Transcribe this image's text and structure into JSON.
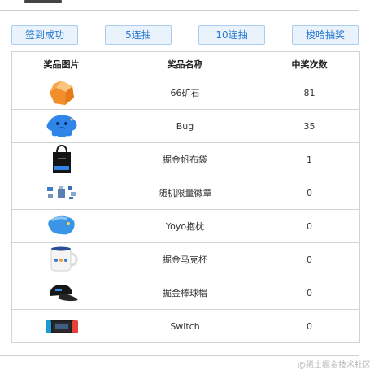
{
  "buttons": {
    "signin": "签到成功",
    "draw5": "5连抽",
    "draw10": "10连抽",
    "peek": "梭哈抽奖"
  },
  "table": {
    "headers": [
      "奖品图片",
      "奖品名称",
      "中奖次数"
    ],
    "rows": [
      {
        "icon": "ore-icon",
        "name": "66矿石",
        "count": "81"
      },
      {
        "icon": "bug-icon",
        "name": "Bug",
        "count": "35"
      },
      {
        "icon": "canvas-bag-icon",
        "name": "掘金帆布袋",
        "count": "1"
      },
      {
        "icon": "badges-icon",
        "name": "随机限量徽章",
        "count": "0"
      },
      {
        "icon": "pillow-icon",
        "name": "Yoyo抱枕",
        "count": "0"
      },
      {
        "icon": "mug-icon",
        "name": "掘金马克杯",
        "count": "0"
      },
      {
        "icon": "baseball-cap-icon",
        "name": "掘金棒球帽",
        "count": "0"
      },
      {
        "icon": "switch-console-icon",
        "name": "Switch",
        "count": "0"
      }
    ]
  },
  "watermark": "@稀土掘金技术社区",
  "colors": {
    "button_bg": "#eaf3fc",
    "button_border": "#a9cdee",
    "button_text": "#2b7ad0",
    "table_border": "#d3d3d3"
  }
}
